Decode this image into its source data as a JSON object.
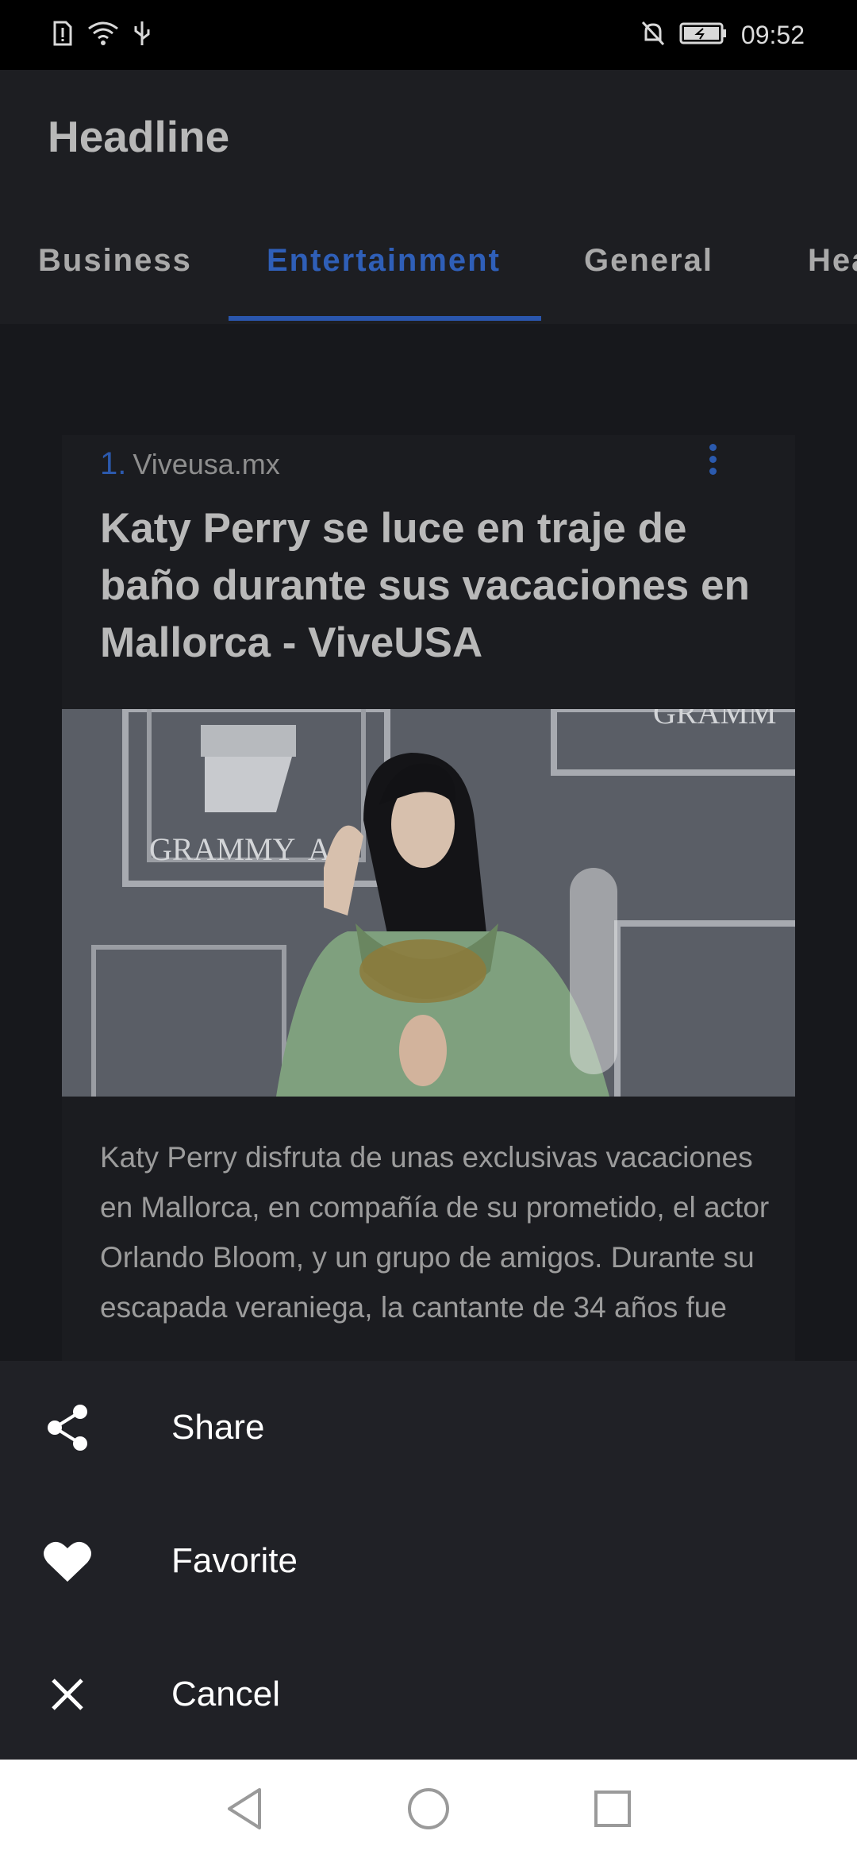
{
  "status_bar": {
    "time": "09:52"
  },
  "app_bar": {
    "title": "Headline"
  },
  "tabs": [
    {
      "label": "Business",
      "active": false
    },
    {
      "label": "Entertainment",
      "active": true
    },
    {
      "label": "General",
      "active": false
    },
    {
      "label": "Health",
      "active": false
    }
  ],
  "article": {
    "index": "1.",
    "source": "Viveusa.mx",
    "title": "Katy Perry se luce en traje de baño durante sus vacaciones en Mallorca - ViveUSA",
    "image_text_1": "GRAMMY",
    "image_text_2": "A",
    "image_text_3": "GRAMM",
    "description": "Katy Perry disfruta de unas exclusivas vacaciones en Mallorca, en compañía de su prometido, el actor Orlando Bloom, y un grupo de amigos. Durante su escapada veraniega, la cantante de 34 años fue"
  },
  "sheet": {
    "items": [
      {
        "label": "Share",
        "icon": "share-icon"
      },
      {
        "label": "Favorite",
        "icon": "heart-icon"
      },
      {
        "label": "Cancel",
        "icon": "close-icon"
      }
    ]
  },
  "nav": {
    "back_icon": "back-triangle-icon",
    "home_icon": "home-circle-icon",
    "recents_icon": "recents-square-icon"
  },
  "colors": {
    "accent": "#2a56ad",
    "background": "#18191d",
    "sheet": "#202126"
  }
}
